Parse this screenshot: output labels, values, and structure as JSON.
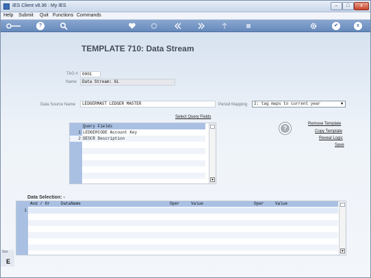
{
  "window": {
    "title": "IES Client v8.36 : My IES",
    "min": "–",
    "max": "□",
    "close": "x"
  },
  "menu": [
    "Help",
    "Submit",
    "Quit",
    "Functions",
    "Commands"
  ],
  "toolbar": {
    "icons": [
      "key-icon",
      "help-icon",
      "search-icon",
      "heart-icon",
      "refresh-icon",
      "back-icon",
      "forward-icon",
      "upload-icon",
      "stop-icon",
      "settings-icon",
      "check-icon",
      "close-icon"
    ],
    "help": "?",
    "check": "✔",
    "close": "x"
  },
  "page": {
    "title": "TEMPLATE 710: Data Stream"
  },
  "form": {
    "tag_label": "TAG #",
    "tag_value": "0001",
    "name_label": "Name",
    "name_value": "Data Stream: GL",
    "source_label": "Data Source Name",
    "source_value": "LEDGERMAST LEDGER MASTER",
    "period_label": "Period Mapping",
    "period_value": "2: tag maps to current year"
  },
  "links": {
    "select_query_fields": "Select Query Fields",
    "remove_template": "Remove Template",
    "copy_template": "Copy Template",
    "reveal_logic": "Reveal Logic",
    "save": "Save"
  },
  "help_button": "?",
  "query_grid": {
    "header": "Query Fields",
    "rows": [
      {
        "num": "1",
        "value": "LEDGERCODE Account Key"
      },
      {
        "num": "2",
        "value": "DESCR Description"
      }
    ]
  },
  "data_selection": {
    "label": "Data Selection: -",
    "headers": {
      "and_or": "And / Or",
      "dataname": "DataName",
      "oper1": "Oper",
      "value1": "Value",
      "oper2": "Oper",
      "value2": "Value"
    },
    "rownum": "1"
  },
  "side": {
    "t": "Ses",
    "b": "E"
  }
}
